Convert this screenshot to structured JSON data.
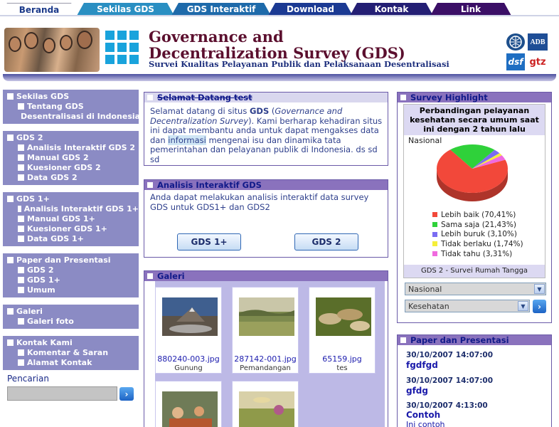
{
  "nav": {
    "tabs": [
      {
        "label": "Beranda",
        "color": "#ffffff",
        "active": true
      },
      {
        "label": "Sekilas GDS",
        "color": "#2a8fc2"
      },
      {
        "label": "GDS Interaktif",
        "color": "#1e6aaa"
      },
      {
        "label": "Download",
        "color": "#1b3a93"
      },
      {
        "label": "Kontak",
        "color": "#241f74"
      },
      {
        "label": "Link",
        "color": "#3b0f66"
      }
    ]
  },
  "header": {
    "title_line1": "Governance and",
    "title_line2": "Decentralization Survey (GDS)",
    "subtitle": "Survei Kualitas Pelayanan Publik dan Pelaksanaan Desentralisasi",
    "partner_logos": [
      "worldbank-logo",
      "ADB",
      "dsf",
      "gtz"
    ]
  },
  "sidebar": {
    "groups": [
      {
        "title": "Sekilas GDS",
        "items": [
          "Tentang GDS",
          "Desentralisasi di Indonesia"
        ]
      },
      {
        "title": "GDS 2",
        "items": [
          "Analisis Interaktif GDS 2",
          "Manual GDS 2",
          "Kuesioner GDS 2",
          "Data GDS 2"
        ]
      },
      {
        "title": "GDS 1+",
        "items": [
          "Analisis Interaktif GDS 1+",
          "Manual GDS 1+",
          "Kuesioner GDS 1+",
          "Data GDS 1+"
        ]
      },
      {
        "title": "Paper dan Presentasi",
        "items": [
          "GDS 2",
          "GDS 1+",
          "Umum"
        ]
      },
      {
        "title": "Galeri",
        "items": [
          "Galeri foto"
        ]
      },
      {
        "title": "Kontak Kami",
        "items": [
          "Komentar & Saran",
          "Alamat Kontak"
        ]
      }
    ],
    "search_label": "Pencarian",
    "search_value": "",
    "search_go": "›"
  },
  "welcome": {
    "heading": "Selamat Datang test",
    "t1": "Selamat datang di situs ",
    "t2": "GDS",
    "t3": " (",
    "t4": "Governance and Decentralization Survey",
    "t5": "). Kami berharap kehadiran situs ini dapat membantu anda untuk dapat mengakses data dan ",
    "t6": "informasi",
    "t7": " mengenai isu dan dinamika tata pemerintahan dan pelayanan publik di Indonesia. ds sd sd"
  },
  "analisis": {
    "heading": "Analisis Interaktif GDS",
    "text": "Anda dapat melakukan analisis interaktif data survey GDS untuk GDS1+ dan GDS2",
    "btn1": "GDS 1+",
    "btn2": "GDS 2"
  },
  "galeri": {
    "heading": "Galeri",
    "items": [
      {
        "file": "880240-003.jpg",
        "caption": "Gunung"
      },
      {
        "file": "287142-001.jpg",
        "caption": "Pemandangan"
      },
      {
        "file": "65159.jpg",
        "caption": "tes"
      },
      {
        "file": "",
        "caption": ""
      },
      {
        "file": "",
        "caption": ""
      }
    ]
  },
  "survey": {
    "heading": "Survey Highlight",
    "footer": "GDS 2 - Survei Rumah Tangga",
    "select1": "Nasional",
    "select2": "Kesehatan",
    "go": "›"
  },
  "chart_data": {
    "type": "pie",
    "title": "Perbandingan pelayanan kesehatan secara umum saat ini dengan 2 tahun lalu",
    "subtitle": "Nasional",
    "categories": [
      "Lebih baik",
      "Sama saja",
      "Lebih buruk",
      "Tidak berlaku",
      "Tidak tahu"
    ],
    "values": [
      70.41,
      21.43,
      3.1,
      1.74,
      3.31
    ],
    "legend_labels": [
      "Lebih baik (70,41%)",
      "Sama saja (21,43%)",
      "Lebih buruk (3,10%)",
      "Tidak berlaku (1,74%)",
      "Tidak tahu (3,31%)"
    ],
    "colors": [
      "#f2483a",
      "#2fd13a",
      "#7a6cf2",
      "#f5ef3a",
      "#f06adf"
    ],
    "legend_position": "bottom"
  },
  "papers": {
    "heading": "Paper dan Presentasi",
    "items": [
      {
        "date": "30/10/2007 14:07:00",
        "title": "fgdfgd",
        "desc": ""
      },
      {
        "date": "30/10/2007 14:07:00",
        "title": "gfdg",
        "desc": ""
      },
      {
        "date": "30/10/2007 4:13:00",
        "title": "Contoh",
        "desc": "Ini contoh"
      }
    ]
  }
}
